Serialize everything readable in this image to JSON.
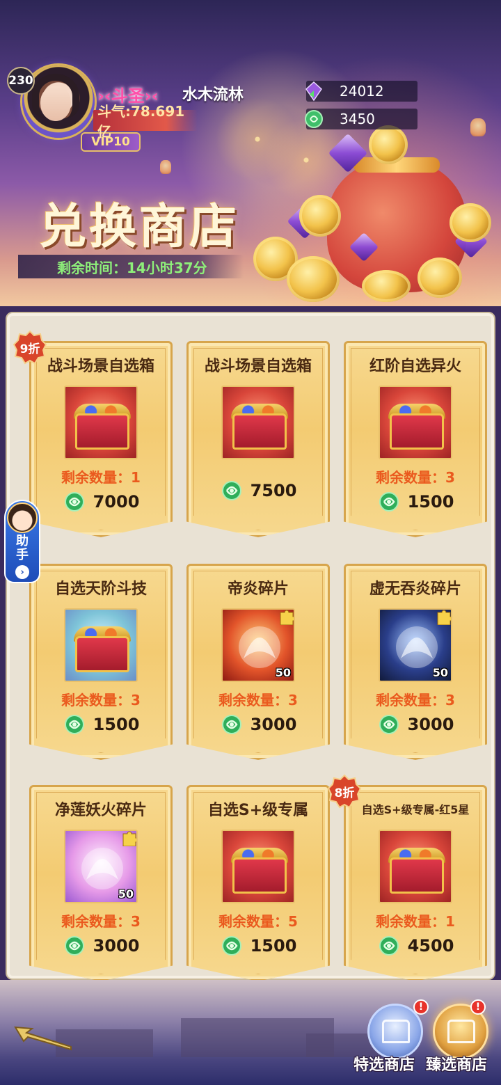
{
  "header": {
    "level": "230",
    "vip": "VIP10",
    "rank_title": "斗圣",
    "player_name": "水木流林",
    "power": "斗气:78.691亿",
    "currencies": [
      {
        "icon": "purple-crystal-icon",
        "value": "24012"
      },
      {
        "icon": "jade-coin-icon",
        "value": "3450"
      }
    ],
    "shop_title": "兑换商店",
    "timer": "剩余时间：14小时37分"
  },
  "helper": {
    "label": "助手"
  },
  "items": [
    {
      "name": "战斗场景自选箱",
      "stock": "剩余数量：1",
      "price": "7000",
      "discount": "9折",
      "art": "chest-red"
    },
    {
      "name": "战斗场景自选箱",
      "stock": "",
      "price": "7500",
      "discount": "",
      "art": "chest-red"
    },
    {
      "name": "红阶自选异火",
      "stock": "剩余数量：3",
      "price": "1500",
      "discount": "",
      "art": "chest-red"
    },
    {
      "name": "自选天阶斗技",
      "stock": "剩余数量：3",
      "price": "1500",
      "discount": "",
      "art": "chest-teal"
    },
    {
      "name": "帝炎碎片",
      "stock": "剩余数量：3",
      "price": "3000",
      "discount": "",
      "art": "fire-fragment",
      "count": "50"
    },
    {
      "name": "虚无吞炎碎片",
      "stock": "剩余数量：3",
      "price": "3000",
      "discount": "",
      "art": "dark-fragment",
      "count": "50"
    },
    {
      "name": "净莲妖火碎片",
      "stock": "剩余数量：3",
      "price": "3000",
      "discount": "",
      "art": "lotus-fragment",
      "count": "50"
    },
    {
      "name": "自选S+级专属",
      "stock": "剩余数量：5",
      "price": "1500",
      "discount": "",
      "art": "chest-red"
    },
    {
      "name": "自选S+级专属-红5星",
      "stock": "剩余数量：1",
      "price": "4500",
      "discount": "8折",
      "art": "chest-red"
    }
  ],
  "footer": {
    "special_shop": "特选商店",
    "select_shop": "臻选商店",
    "alert_mark": "!"
  },
  "colors": {
    "stock_text": "#ea5a1e",
    "card_gold": "#f3cb72",
    "discount_red": "#d9452a",
    "timer_green": "#8ef07a"
  }
}
